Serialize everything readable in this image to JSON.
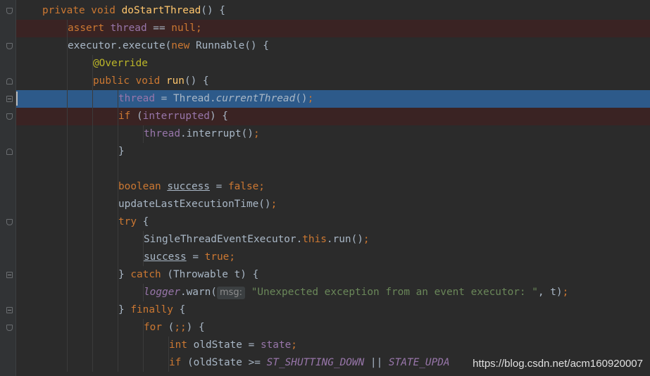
{
  "code_lines": [
    {
      "indent": 1,
      "parts": [
        [
          "private void ",
          "kw"
        ],
        [
          "doStartThread",
          "fn"
        ],
        [
          "() {",
          ""
        ]
      ]
    },
    {
      "indent": 2,
      "err": true,
      "parts": [
        [
          "assert ",
          "kw"
        ],
        [
          "thread",
          "fld"
        ],
        [
          " == ",
          ""
        ],
        [
          "null",
          "kw"
        ],
        [
          ";",
          "kw"
        ]
      ]
    },
    {
      "indent": 2,
      "parts": [
        [
          "executor",
          ""
        ],
        [
          ".execute(",
          ""
        ],
        [
          "new ",
          "kw"
        ],
        [
          "Runnable() {",
          ""
        ]
      ]
    },
    {
      "indent": 3,
      "parts": [
        [
          "@Override",
          "ann"
        ]
      ]
    },
    {
      "indent": 3,
      "parts": [
        [
          "public void ",
          "kw"
        ],
        [
          "run",
          "fn"
        ],
        [
          "() {",
          ""
        ]
      ]
    },
    {
      "indent": 4,
      "sel": true,
      "parts": [
        [
          "thread",
          "fld"
        ],
        [
          " = Thread.",
          ""
        ],
        [
          "currentThread",
          "it"
        ],
        [
          "()",
          ""
        ],
        [
          ";",
          "kw"
        ]
      ]
    },
    {
      "indent": 4,
      "err": true,
      "parts": [
        [
          "if ",
          "kw"
        ],
        [
          "(",
          ""
        ],
        [
          "interrupted",
          "fld"
        ],
        [
          ") {",
          ""
        ]
      ]
    },
    {
      "indent": 5,
      "parts": [
        [
          "thread",
          "fld"
        ],
        [
          ".interrupt()",
          ""
        ],
        [
          ";",
          "kw"
        ]
      ]
    },
    {
      "indent": 4,
      "parts": [
        [
          "}",
          ""
        ]
      ]
    },
    {
      "indent": 4,
      "parts": [
        [
          "",
          ""
        ]
      ]
    },
    {
      "indent": 4,
      "parts": [
        [
          "boolean ",
          "kw"
        ],
        [
          "success",
          "ul"
        ],
        [
          " = ",
          ""
        ],
        [
          "false",
          "kw"
        ],
        [
          ";",
          "kw"
        ]
      ]
    },
    {
      "indent": 4,
      "parts": [
        [
          "updateLastExecutionTime()",
          ""
        ],
        [
          ";",
          "kw"
        ]
      ]
    },
    {
      "indent": 4,
      "parts": [
        [
          "try ",
          "kw"
        ],
        [
          "{",
          ""
        ]
      ]
    },
    {
      "indent": 5,
      "parts": [
        [
          "SingleThreadEventExecutor.",
          ""
        ],
        [
          "this",
          "kw"
        ],
        [
          ".run()",
          ""
        ],
        [
          ";",
          "kw"
        ]
      ]
    },
    {
      "indent": 5,
      "parts": [
        [
          "success",
          "ul"
        ],
        [
          " = ",
          ""
        ],
        [
          "true",
          "kw"
        ],
        [
          ";",
          "kw"
        ]
      ]
    },
    {
      "indent": 4,
      "parts": [
        [
          "} ",
          ""
        ],
        [
          "catch ",
          "kw"
        ],
        [
          "(Throwable t) {",
          ""
        ]
      ]
    },
    {
      "indent": 5,
      "parts": [
        [
          "logger",
          "st"
        ],
        [
          ".warn(",
          ""
        ],
        [
          "msg:",
          "hint"
        ],
        [
          "\"Unexpected exception from an event executor: \"",
          "str"
        ],
        [
          ", t)",
          ""
        ],
        [
          ";",
          "kw"
        ]
      ]
    },
    {
      "indent": 4,
      "parts": [
        [
          "} ",
          ""
        ],
        [
          "finally ",
          "kw"
        ],
        [
          "{",
          ""
        ]
      ]
    },
    {
      "indent": 5,
      "parts": [
        [
          "for ",
          "kw"
        ],
        [
          "(",
          ""
        ],
        [
          ";;",
          "kw"
        ],
        [
          ") {",
          ""
        ]
      ]
    },
    {
      "indent": 6,
      "parts": [
        [
          "int ",
          "kw"
        ],
        [
          "oldState = ",
          ""
        ],
        [
          "state",
          "fld"
        ],
        [
          ";",
          "kw"
        ]
      ]
    },
    {
      "indent": 6,
      "parts": [
        [
          "if ",
          "kw"
        ],
        [
          "(oldState >= ",
          ""
        ],
        [
          "ST_SHUTTING_DOWN",
          "st"
        ],
        [
          " || ",
          ""
        ],
        [
          "STATE_UPDA",
          "st"
        ]
      ]
    }
  ],
  "fold_markers": [
    {
      "line": 0,
      "kind": "down"
    },
    {
      "line": 2,
      "kind": "down"
    },
    {
      "line": 4,
      "kind": "up"
    },
    {
      "line": 5,
      "kind": "open"
    },
    {
      "line": 6,
      "kind": "down"
    },
    {
      "line": 8,
      "kind": "up"
    },
    {
      "line": 12,
      "kind": "down"
    },
    {
      "line": 15,
      "kind": "open"
    },
    {
      "line": 17,
      "kind": "open"
    },
    {
      "line": 18,
      "kind": "down"
    }
  ],
  "watermark": "https://blog.csdn.net/acm160920007"
}
